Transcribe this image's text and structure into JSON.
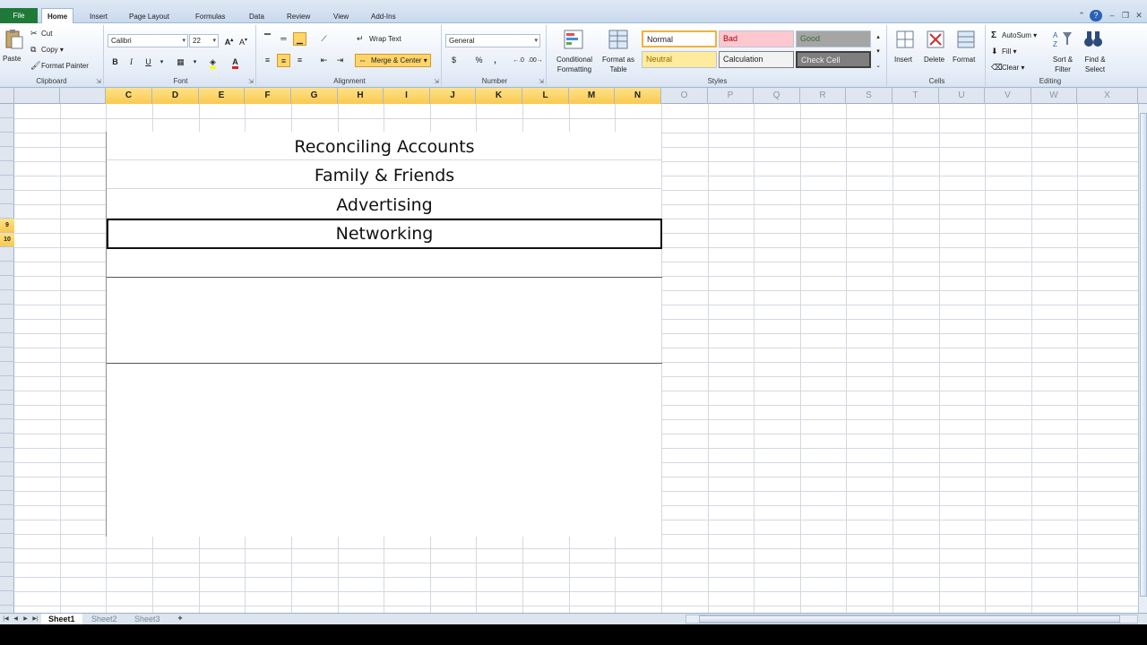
{
  "tabs": {
    "file": "File",
    "items": [
      "Home",
      "Insert",
      "Page Layout",
      "Formulas",
      "Data",
      "Review",
      "View",
      "Add-Ins"
    ],
    "active": "Home"
  },
  "clipboard": {
    "label": "Clipboard",
    "paste": "Paste",
    "cut": "Cut",
    "copy": "Copy",
    "format_painter": "Format Painter"
  },
  "font": {
    "label": "Font",
    "name": "Calibri",
    "size": "22",
    "bold": "B",
    "italic": "I",
    "underline": "U"
  },
  "alignment": {
    "label": "Alignment",
    "wrap_text": "Wrap Text",
    "merge_center": "Merge & Center"
  },
  "number": {
    "label": "Number",
    "format": "General",
    "currency": "$",
    "percent": "%",
    "comma": ","
  },
  "styles": {
    "label": "Styles",
    "conditional": "Conditional Formatting",
    "format_table": "Format as Table",
    "cells": [
      {
        "name": "Normal",
        "bg": "#ffffff"
      },
      {
        "name": "Bad",
        "bg": "#ffc7ce"
      },
      {
        "name": "Good",
        "bg": "#c6efce"
      },
      {
        "name": "Neutral",
        "bg": "#ffeb9c"
      },
      {
        "name": "Calculation",
        "bg": "#f2f2f2"
      },
      {
        "name": "Check Cell",
        "bg": "#a5a5a5"
      }
    ]
  },
  "cells": {
    "label": "Cells",
    "insert": "Insert",
    "delete": "Delete",
    "format": "Format"
  },
  "editing": {
    "label": "Editing",
    "autosum": "AutoSum",
    "fill": "Fill",
    "clear": "Clear",
    "sort_filter": "Sort & Filter",
    "find_select": "Find & Select"
  },
  "columns": {
    "left_faint": [
      "",
      ""
    ],
    "selected": [
      "C",
      "D",
      "E",
      "F",
      "G",
      "H",
      "I",
      "J",
      "K",
      "L",
      "M",
      "N"
    ],
    "right_faint": [
      "O",
      "P",
      "Q",
      "R",
      "S",
      "T",
      "U",
      "V",
      "W",
      "X"
    ]
  },
  "rows": {
    "selected": [
      "9",
      "10"
    ]
  },
  "sheet": {
    "entries": [
      "Reconciling Accounts",
      "Family & Friends",
      "Advertising",
      "Networking"
    ],
    "active_index": 3
  },
  "sheet_tabs": [
    "Sheet1",
    "Sheet2",
    "Sheet3"
  ],
  "active_sheet": "Sheet1"
}
